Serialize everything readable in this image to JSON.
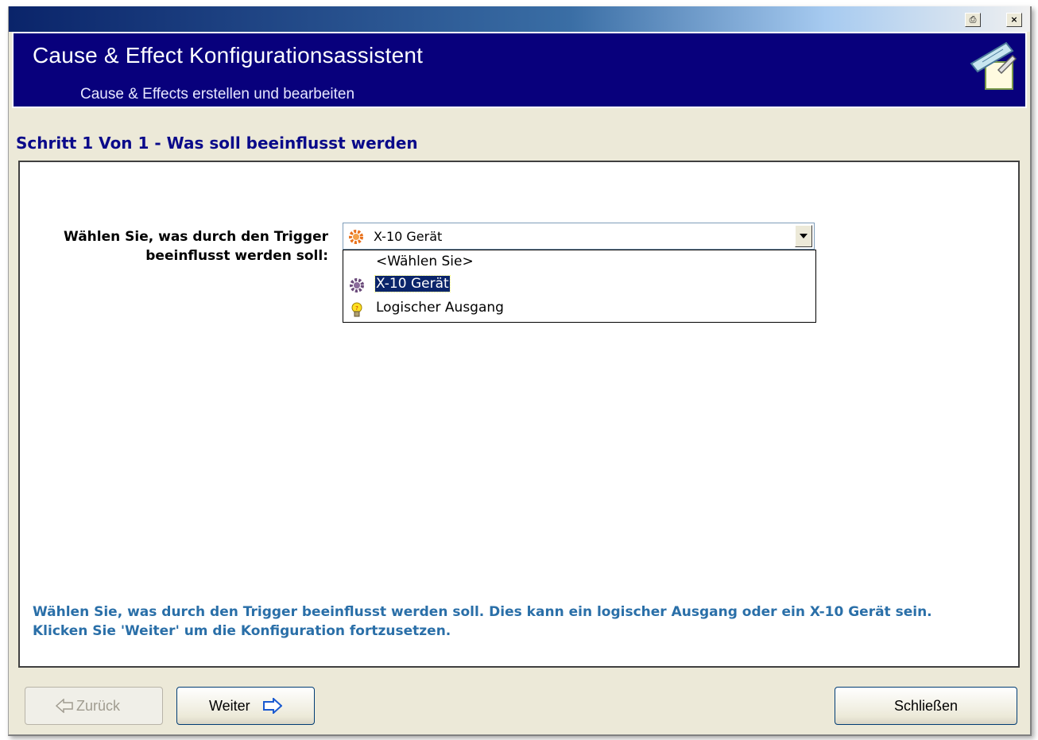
{
  "window": {
    "print_button": "⎙",
    "close_button": "×"
  },
  "header": {
    "title": "Cause & Effect Konfigurationsassistent",
    "subtitle": "Cause & Effects erstellen und bearbeiten",
    "icon": "pencil-ruler-icon"
  },
  "step_title": "Schritt 1 Von 1 - Was soll beeinflusst werden",
  "prompt": {
    "line1": "Wählen Sie, was durch den Trigger",
    "line2": "beeinflusst werden soll:"
  },
  "combo": {
    "selected_value": "X-10 Gerät",
    "selected_icon": "x10-device-icon",
    "options": [
      {
        "label": "<Wählen Sie>",
        "icon": ""
      },
      {
        "label": "X-10 Gerät",
        "icon": "x10-device-icon",
        "selected": true
      },
      {
        "label": "Logischer Ausgang",
        "icon": "lightbulb-icon"
      }
    ]
  },
  "help": {
    "line1": "Wählen Sie, was durch den Trigger beeinflusst werden soll. Dies kann ein logischer Ausgang oder ein X-10 Gerät sein.",
    "line2": "Klicken Sie 'Weiter' um die Konfiguration fortzusetzen."
  },
  "buttons": {
    "back": "Zurück",
    "next": "Weiter",
    "close": "Schließen"
  },
  "colors": {
    "header_bg": "#08007c",
    "step_title": "#0a0a8a",
    "help_text": "#2a6fa8",
    "selection": "#0a246a"
  }
}
